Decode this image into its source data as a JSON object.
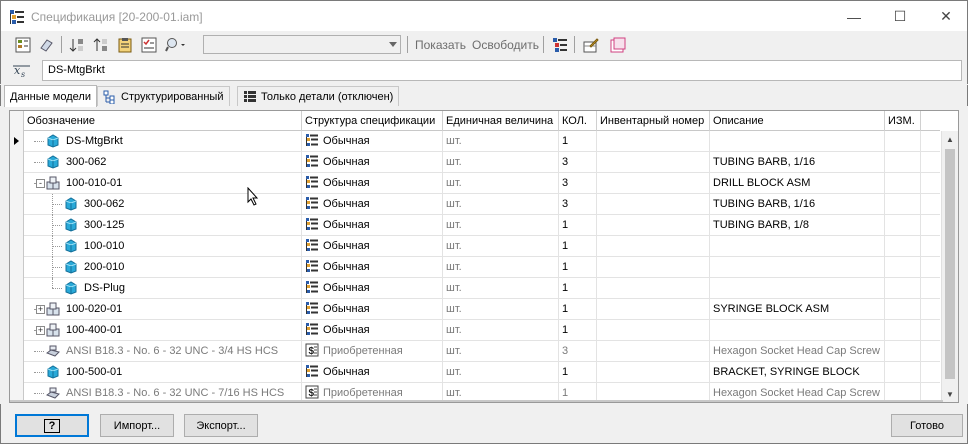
{
  "window": {
    "title": "Спецификация [20-200-01.iam]",
    "minimize_glyph": "—",
    "maximize_glyph": "☐",
    "close_glyph": "✕"
  },
  "toolbar": {
    "combo_value": "",
    "show_label": "Показать",
    "release_label": "Освободить"
  },
  "formula": {
    "name_value": "DS-MtgBrkt"
  },
  "tabs": [
    {
      "label": "Данные модели"
    },
    {
      "label": "Структурированный"
    },
    {
      "label": "Только детали (отключен)"
    }
  ],
  "columns": [
    "Обозначение",
    "Структура спецификации",
    "Единичная величина",
    "КОЛ.",
    "Инвентарный номер",
    "Описание",
    "ИЗМ."
  ],
  "rows": [
    {
      "name": "DS-MtgBrkt",
      "structure": "Обычная",
      "unit": "шт.",
      "qty": "1",
      "inventory": "",
      "description": "",
      "rev": ""
    },
    {
      "name": "300-062",
      "structure": "Обычная",
      "unit": "шт.",
      "qty": "3",
      "inventory": "",
      "description": "TUBING BARB, 1/16",
      "rev": ""
    },
    {
      "name": "100-010-01",
      "structure": "Обычная",
      "unit": "шт.",
      "qty": "3",
      "inventory": "",
      "description": "DRILL BLOCK ASM",
      "rev": ""
    },
    {
      "name": "300-062",
      "structure": "Обычная",
      "unit": "шт.",
      "qty": "3",
      "inventory": "",
      "description": "TUBING BARB, 1/16",
      "rev": ""
    },
    {
      "name": "300-125",
      "structure": "Обычная",
      "unit": "шт.",
      "qty": "1",
      "inventory": "",
      "description": "TUBING BARB, 1/8",
      "rev": ""
    },
    {
      "name": "100-010",
      "structure": "Обычная",
      "unit": "шт.",
      "qty": "1",
      "inventory": "",
      "description": "",
      "rev": ""
    },
    {
      "name": "200-010",
      "structure": "Обычная",
      "unit": "шт.",
      "qty": "1",
      "inventory": "",
      "description": "",
      "rev": ""
    },
    {
      "name": "DS-Plug",
      "structure": "Обычная",
      "unit": "шт.",
      "qty": "1",
      "inventory": "",
      "description": "",
      "rev": ""
    },
    {
      "name": "100-020-01",
      "structure": "Обычная",
      "unit": "шт.",
      "qty": "1",
      "inventory": "",
      "description": "SYRINGE BLOCK ASM",
      "rev": ""
    },
    {
      "name": "100-400-01",
      "structure": "Обычная",
      "unit": "шт.",
      "qty": "1",
      "inventory": "",
      "description": "",
      "rev": ""
    },
    {
      "name": "ANSI B18.3 - No. 6 - 32 UNC - 3/4 HS HCS",
      "structure": "Приобретенная",
      "unit": "шт.",
      "qty": "3",
      "inventory": "",
      "description": "Hexagon Socket Head Cap Screw",
      "rev": ""
    },
    {
      "name": "100-500-01",
      "structure": "Обычная",
      "unit": "шт.",
      "qty": "1",
      "inventory": "",
      "description": "BRACKET, SYRINGE BLOCK",
      "rev": ""
    },
    {
      "name": "ANSI B18.3 - No. 6 - 32 UNC - 7/16 HS HCS",
      "structure": "Приобретенная",
      "unit": "шт.",
      "qty": "1",
      "inventory": "",
      "description": "Hexagon Socket Head Cap Screw",
      "rev": ""
    }
  ],
  "footer": {
    "help_glyph": "?",
    "import_label": "Импорт...",
    "export_label": "Экспорт...",
    "done_label": "Готово"
  },
  "colors": {
    "part_blue": "#29a9d8",
    "assembly_grey": "#a0b4c8",
    "purchased_grey": "#7a7a7a",
    "focus_blue": "#0078d7"
  }
}
